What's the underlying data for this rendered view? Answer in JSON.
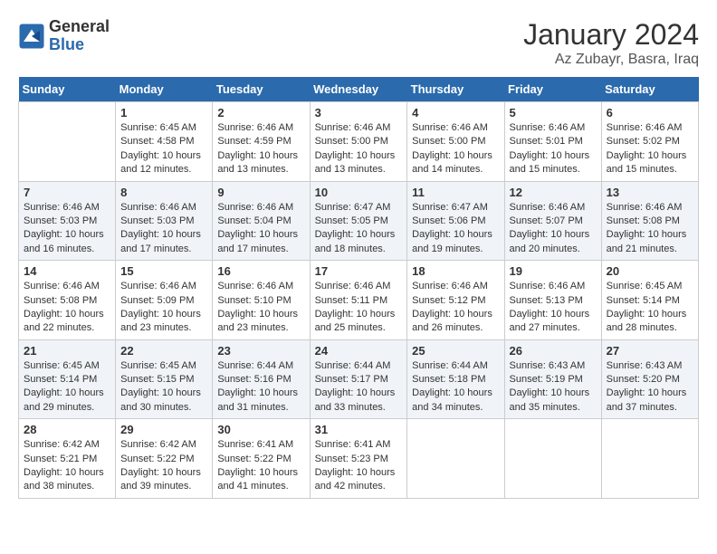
{
  "logo": {
    "general": "General",
    "blue": "Blue"
  },
  "title": "January 2024",
  "subtitle": "Az Zubayr, Basra, Iraq",
  "headers": [
    "Sunday",
    "Monday",
    "Tuesday",
    "Wednesday",
    "Thursday",
    "Friday",
    "Saturday"
  ],
  "weeks": [
    [
      {
        "day": "",
        "info": ""
      },
      {
        "day": "1",
        "info": "Sunrise: 6:45 AM\nSunset: 4:58 PM\nDaylight: 10 hours\nand 12 minutes."
      },
      {
        "day": "2",
        "info": "Sunrise: 6:46 AM\nSunset: 4:59 PM\nDaylight: 10 hours\nand 13 minutes."
      },
      {
        "day": "3",
        "info": "Sunrise: 6:46 AM\nSunset: 5:00 PM\nDaylight: 10 hours\nand 13 minutes."
      },
      {
        "day": "4",
        "info": "Sunrise: 6:46 AM\nSunset: 5:00 PM\nDaylight: 10 hours\nand 14 minutes."
      },
      {
        "day": "5",
        "info": "Sunrise: 6:46 AM\nSunset: 5:01 PM\nDaylight: 10 hours\nand 15 minutes."
      },
      {
        "day": "6",
        "info": "Sunrise: 6:46 AM\nSunset: 5:02 PM\nDaylight: 10 hours\nand 15 minutes."
      }
    ],
    [
      {
        "day": "7",
        "info": "Sunrise: 6:46 AM\nSunset: 5:03 PM\nDaylight: 10 hours\nand 16 minutes."
      },
      {
        "day": "8",
        "info": "Sunrise: 6:46 AM\nSunset: 5:03 PM\nDaylight: 10 hours\nand 17 minutes."
      },
      {
        "day": "9",
        "info": "Sunrise: 6:46 AM\nSunset: 5:04 PM\nDaylight: 10 hours\nand 17 minutes."
      },
      {
        "day": "10",
        "info": "Sunrise: 6:47 AM\nSunset: 5:05 PM\nDaylight: 10 hours\nand 18 minutes."
      },
      {
        "day": "11",
        "info": "Sunrise: 6:47 AM\nSunset: 5:06 PM\nDaylight: 10 hours\nand 19 minutes."
      },
      {
        "day": "12",
        "info": "Sunrise: 6:46 AM\nSunset: 5:07 PM\nDaylight: 10 hours\nand 20 minutes."
      },
      {
        "day": "13",
        "info": "Sunrise: 6:46 AM\nSunset: 5:08 PM\nDaylight: 10 hours\nand 21 minutes."
      }
    ],
    [
      {
        "day": "14",
        "info": "Sunrise: 6:46 AM\nSunset: 5:08 PM\nDaylight: 10 hours\nand 22 minutes."
      },
      {
        "day": "15",
        "info": "Sunrise: 6:46 AM\nSunset: 5:09 PM\nDaylight: 10 hours\nand 23 minutes."
      },
      {
        "day": "16",
        "info": "Sunrise: 6:46 AM\nSunset: 5:10 PM\nDaylight: 10 hours\nand 23 minutes."
      },
      {
        "day": "17",
        "info": "Sunrise: 6:46 AM\nSunset: 5:11 PM\nDaylight: 10 hours\nand 25 minutes."
      },
      {
        "day": "18",
        "info": "Sunrise: 6:46 AM\nSunset: 5:12 PM\nDaylight: 10 hours\nand 26 minutes."
      },
      {
        "day": "19",
        "info": "Sunrise: 6:46 AM\nSunset: 5:13 PM\nDaylight: 10 hours\nand 27 minutes."
      },
      {
        "day": "20",
        "info": "Sunrise: 6:45 AM\nSunset: 5:14 PM\nDaylight: 10 hours\nand 28 minutes."
      }
    ],
    [
      {
        "day": "21",
        "info": "Sunrise: 6:45 AM\nSunset: 5:14 PM\nDaylight: 10 hours\nand 29 minutes."
      },
      {
        "day": "22",
        "info": "Sunrise: 6:45 AM\nSunset: 5:15 PM\nDaylight: 10 hours\nand 30 minutes."
      },
      {
        "day": "23",
        "info": "Sunrise: 6:44 AM\nSunset: 5:16 PM\nDaylight: 10 hours\nand 31 minutes."
      },
      {
        "day": "24",
        "info": "Sunrise: 6:44 AM\nSunset: 5:17 PM\nDaylight: 10 hours\nand 33 minutes."
      },
      {
        "day": "25",
        "info": "Sunrise: 6:44 AM\nSunset: 5:18 PM\nDaylight: 10 hours\nand 34 minutes."
      },
      {
        "day": "26",
        "info": "Sunrise: 6:43 AM\nSunset: 5:19 PM\nDaylight: 10 hours\nand 35 minutes."
      },
      {
        "day": "27",
        "info": "Sunrise: 6:43 AM\nSunset: 5:20 PM\nDaylight: 10 hours\nand 37 minutes."
      }
    ],
    [
      {
        "day": "28",
        "info": "Sunrise: 6:42 AM\nSunset: 5:21 PM\nDaylight: 10 hours\nand 38 minutes."
      },
      {
        "day": "29",
        "info": "Sunrise: 6:42 AM\nSunset: 5:22 PM\nDaylight: 10 hours\nand 39 minutes."
      },
      {
        "day": "30",
        "info": "Sunrise: 6:41 AM\nSunset: 5:22 PM\nDaylight: 10 hours\nand 41 minutes."
      },
      {
        "day": "31",
        "info": "Sunrise: 6:41 AM\nSunset: 5:23 PM\nDaylight: 10 hours\nand 42 minutes."
      },
      {
        "day": "",
        "info": ""
      },
      {
        "day": "",
        "info": ""
      },
      {
        "day": "",
        "info": ""
      }
    ]
  ]
}
